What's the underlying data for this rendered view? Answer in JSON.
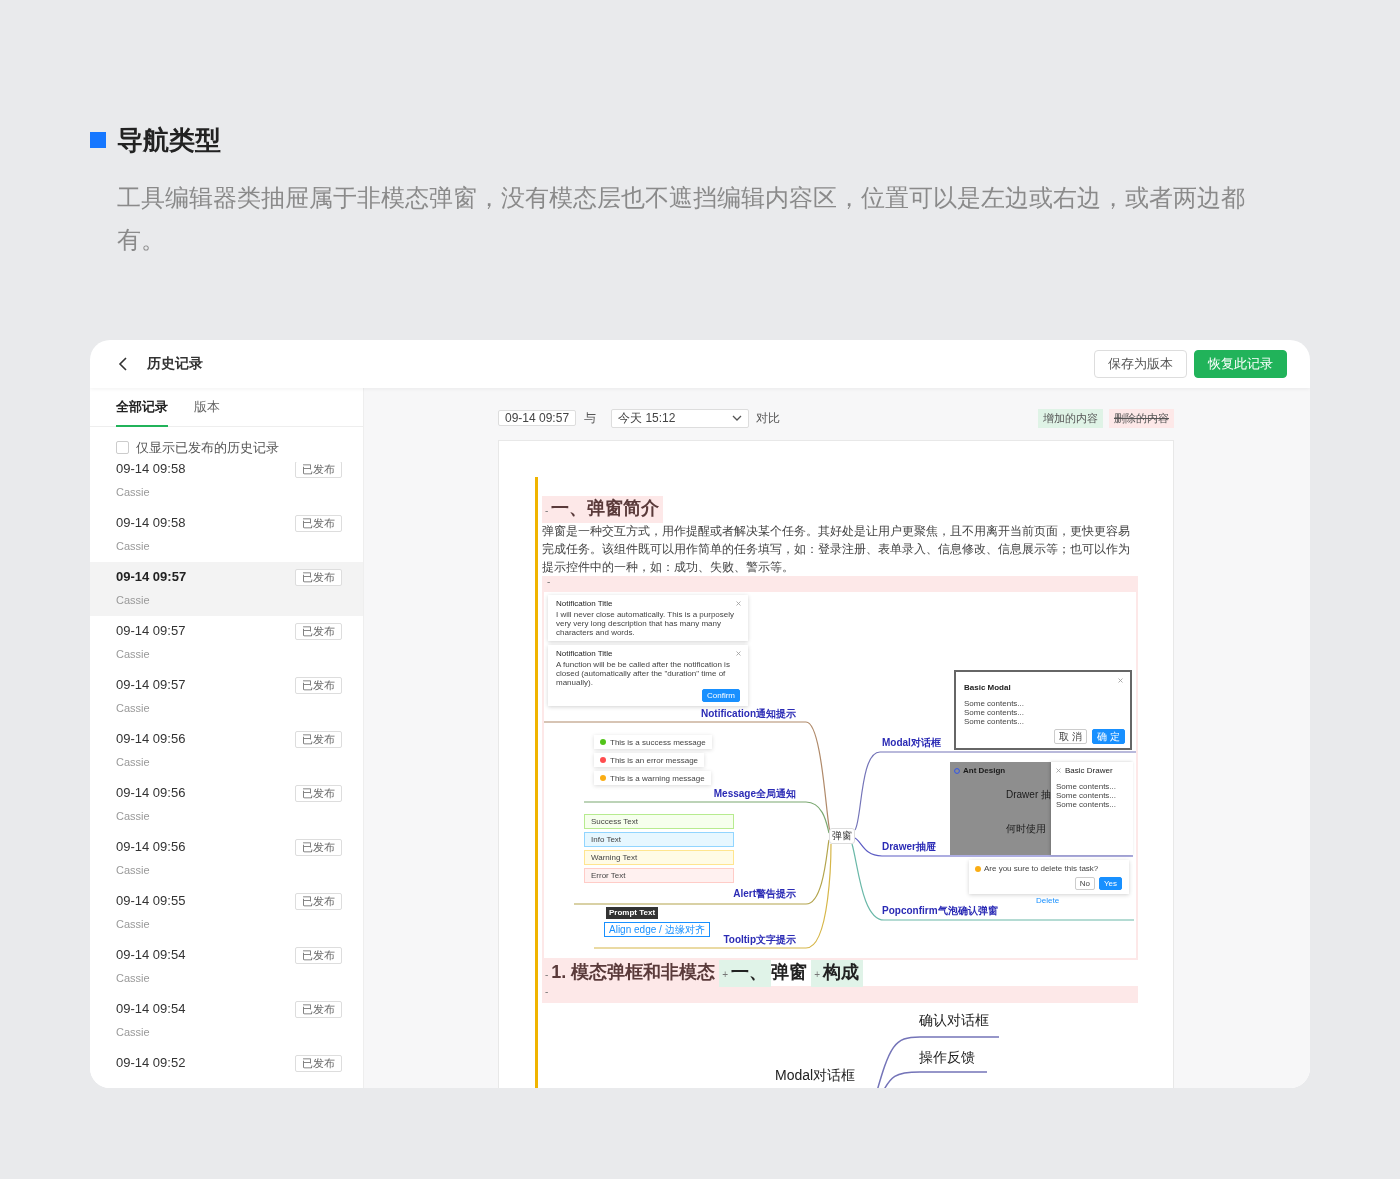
{
  "section": {
    "title": "导航类型",
    "description": "工具编辑器类抽屉属于非模态弹窗，没有模态层也不遮挡编辑内容区，位置可以是左边或右边，或者两边都有。"
  },
  "app": {
    "title": "历史记录",
    "buttons": [
      {
        "label": "保存为版本",
        "kind": "default"
      },
      {
        "label": "恢复此记录",
        "kind": "primary"
      }
    ]
  },
  "sidebar": {
    "tabs": [
      {
        "label": "全部记录",
        "selected": true
      },
      {
        "label": "版本",
        "selected": false
      }
    ],
    "filter": {
      "label": "仅显示已发布的历史记录",
      "checked": false
    },
    "records": [
      {
        "time": "09-14 09:58",
        "author": "Cassie",
        "badge": "已发布",
        "selected": false
      },
      {
        "time": "09-14 09:58",
        "author": "Cassie",
        "badge": "已发布",
        "selected": false
      },
      {
        "time": "09-14 09:57",
        "author": "Cassie",
        "badge": "已发布",
        "selected": true
      },
      {
        "time": "09-14 09:57",
        "author": "Cassie",
        "badge": "已发布",
        "selected": false
      },
      {
        "time": "09-14 09:57",
        "author": "Cassie",
        "badge": "已发布",
        "selected": false
      },
      {
        "time": "09-14 09:56",
        "author": "Cassie",
        "badge": "已发布",
        "selected": false
      },
      {
        "time": "09-14 09:56",
        "author": "Cassie",
        "badge": "已发布",
        "selected": false
      },
      {
        "time": "09-14 09:56",
        "author": "Cassie",
        "badge": "已发布",
        "selected": false
      },
      {
        "time": "09-14 09:55",
        "author": "Cassie",
        "badge": "已发布",
        "selected": false
      },
      {
        "time": "09-14 09:54",
        "author": "Cassie",
        "badge": "已发布",
        "selected": false
      },
      {
        "time": "09-14 09:54",
        "author": "Cassie",
        "badge": "已发布",
        "selected": false
      },
      {
        "time": "09-14 09:52",
        "badge": "已发布",
        "selected": false
      }
    ]
  },
  "compare": {
    "from": "09-14 09:57",
    "joiner": "与",
    "to": "今天 15:12",
    "action": "对比",
    "legend": [
      {
        "label": "增加的内容",
        "kind": "added"
      },
      {
        "label": "删除的内容",
        "kind": "removed"
      }
    ]
  },
  "document": {
    "blocks": [
      {
        "kind": "heading",
        "segments": [
          {
            "kind": "removed",
            "marker": "-",
            "text": "一、弹窗简介"
          }
        ]
      },
      {
        "kind": "paragraph",
        "text": "弹窗是一种交互方式，用作提醒或者解决某个任务。其好处是让用户更聚焦，且不用离开当前页面，更快更容易完成任务。该组件既可以用作简单的任务填写，如：登录注册、表单录入、信息修改、信息展示等；也可以作为提示控件中的一种，如：成功、失败、警示等。"
      },
      {
        "kind": "popup_map",
        "marker": "-",
        "center": "弹窗",
        "branches": [
          {
            "kind": "notification",
            "label": "Notification通知提示",
            "color": "#b08a6a",
            "cards": [
              {
                "title": "Notification Title",
                "text": "I will never close automatically. This is a purposely very very long description that has many many characters and words."
              },
              {
                "title": "Notification Title",
                "text": "A function will be be called after the notification is closed (automatically after the \"duration\" time of manually).",
                "button": "Confirm"
              }
            ]
          },
          {
            "kind": "message",
            "label": "Message全局通知",
            "color": "#7aa870",
            "messages": [
              {
                "kind": "success",
                "text": "This is a success message"
              },
              {
                "kind": "error",
                "text": "This is an error message"
              },
              {
                "kind": "warning",
                "text": "This is a warning message"
              }
            ]
          },
          {
            "kind": "alert",
            "label": "Alert警告提示",
            "color": "#b3a44c",
            "alerts": [
              {
                "kind": "success",
                "text": "Success Text"
              },
              {
                "kind": "info",
                "text": "Info Text"
              },
              {
                "kind": "warning",
                "text": "Warning Text"
              },
              {
                "kind": "error",
                "text": "Error Text"
              }
            ]
          },
          {
            "kind": "tooltip",
            "label": "Tooltip文字提示",
            "color": "#d6b648",
            "tip": "Prompt Text",
            "button": "Align edge / 边缘对齐"
          },
          {
            "kind": "modal",
            "label": "Modal对话框",
            "color": "#7474b8",
            "title": "Basic Modal",
            "lines": [
              "Some contents...",
              "Some contents...",
              "Some contents..."
            ],
            "buttons": [
              {
                "label": "取 消",
                "kind": "default"
              },
              {
                "label": "确 定",
                "kind": "primary"
              }
            ]
          },
          {
            "kind": "drawer",
            "label": "Drawer抽屉",
            "color": "#5c5cc4",
            "app": "Ant Design",
            "heading": "Drawer 抽",
            "subheading": "何时使用",
            "panel_title": "Basic Drawer",
            "lines": [
              "Some contents...",
              "Some contents...",
              "Some contents..."
            ]
          },
          {
            "kind": "popconfirm",
            "label": "Popconfirm气泡确认弹窗",
            "color": "#6ab8a8",
            "question": "Are you sure to delete this task?",
            "buttons": [
              {
                "label": "No",
                "kind": "default"
              },
              {
                "label": "Yes",
                "kind": "primary"
              }
            ],
            "link": "Delete"
          }
        ]
      },
      {
        "kind": "heading",
        "segments": [
          {
            "kind": "removed",
            "marker": "-",
            "text": "1. 模态弹框和非模态"
          },
          {
            "kind": "added",
            "marker": "+",
            "text": "一、"
          },
          {
            "kind": "plain",
            "text": "弹窗"
          },
          {
            "kind": "added",
            "marker": "+",
            "text": "构成"
          }
        ]
      },
      {
        "kind": "removed_line",
        "marker": "-"
      },
      {
        "kind": "modal_map",
        "root": "Modal对话框",
        "children": [
          "确认对话框",
          "操作反馈"
        ]
      }
    ]
  }
}
